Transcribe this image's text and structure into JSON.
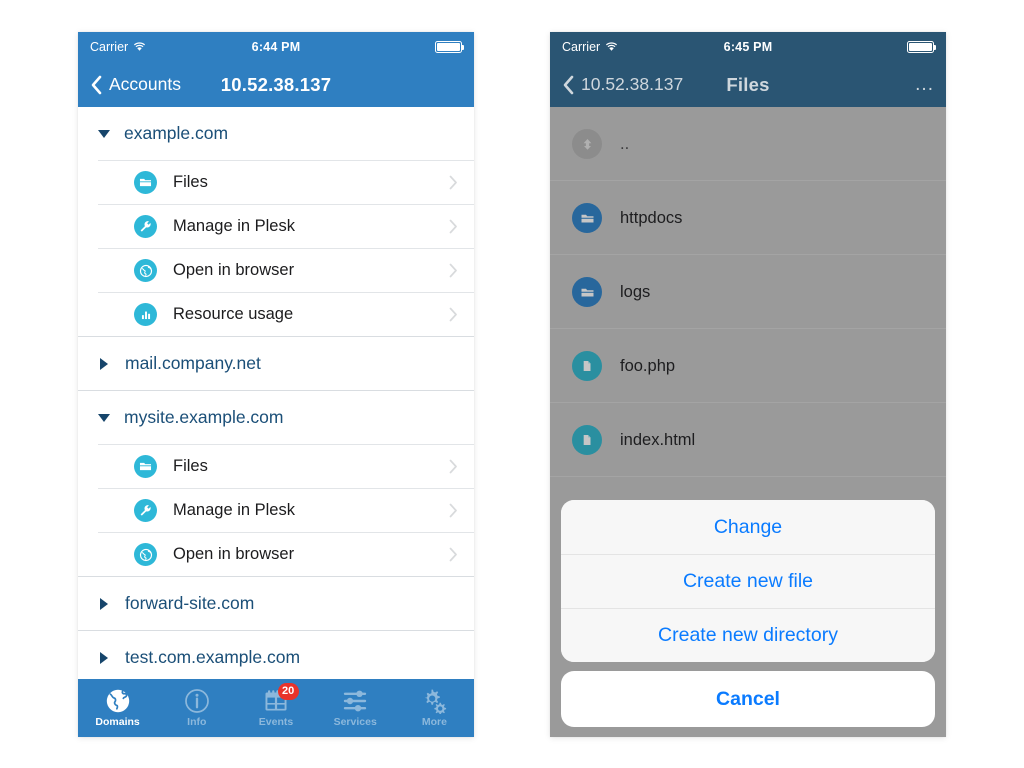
{
  "colors": {
    "nav_blue": "#2f7fc1",
    "nav_blue_dimmed": "#2a5573",
    "icon_cyan": "#2eb8d8",
    "domain_text": "#1b4f78",
    "badge_red": "#e8332a",
    "action_blue": "#0a7bff",
    "dim_overlay": "#9a9a9a",
    "dir_icon_blue": "#28679c",
    "file_icon_teal": "#2a8fa0"
  },
  "left_phone": {
    "status_bar": {
      "carrier": "Carrier",
      "wifi_icon": "wifi-icon",
      "time": "6:44 PM",
      "battery_icon": "battery-full-icon"
    },
    "nav": {
      "back_icon": "chevron-left-icon",
      "back_label": "Accounts",
      "title": "10.52.38.137"
    },
    "groups": [
      {
        "domain": "example.com",
        "expanded": true,
        "disclosure_icon": "triangle-down-icon",
        "items": [
          {
            "label": "Files",
            "icon": "folder-icon",
            "chevron": "chevron-right-icon"
          },
          {
            "label": "Manage in Plesk",
            "icon": "wrench-icon",
            "chevron": "chevron-right-icon"
          },
          {
            "label": "Open in browser",
            "icon": "globe-icon",
            "chevron": "chevron-right-icon"
          },
          {
            "label": "Resource usage",
            "icon": "bar-chart-icon",
            "chevron": "chevron-right-icon"
          }
        ]
      },
      {
        "domain": "mail.company.net",
        "expanded": false,
        "disclosure_icon": "triangle-right-icon",
        "items": []
      },
      {
        "domain": "mysite.example.com",
        "expanded": true,
        "disclosure_icon": "triangle-down-icon",
        "items": [
          {
            "label": "Files",
            "icon": "folder-icon",
            "chevron": "chevron-right-icon"
          },
          {
            "label": "Manage in Plesk",
            "icon": "wrench-icon",
            "chevron": "chevron-right-icon"
          },
          {
            "label": "Open in browser",
            "icon": "globe-icon",
            "chevron": "chevron-right-icon"
          }
        ]
      },
      {
        "domain": "forward-site.com",
        "expanded": false,
        "disclosure_icon": "triangle-right-icon",
        "items": []
      },
      {
        "domain": "test.com.example.com",
        "expanded": false,
        "disclosure_icon": "triangle-right-icon",
        "items": []
      }
    ],
    "tabbar": [
      {
        "label": "Domains",
        "icon": "globe-icon",
        "active": true,
        "badge": null
      },
      {
        "label": "Info",
        "icon": "info-icon",
        "active": false,
        "badge": null
      },
      {
        "label": "Events",
        "icon": "calendar-icon",
        "active": false,
        "badge": "20"
      },
      {
        "label": "Services",
        "icon": "sliders-icon",
        "active": false,
        "badge": null
      },
      {
        "label": "More",
        "icon": "gears-icon",
        "active": false,
        "badge": null
      }
    ]
  },
  "right_phone": {
    "status_bar": {
      "carrier": "Carrier",
      "wifi_icon": "wifi-icon",
      "time": "6:45 PM",
      "battery_icon": "battery-full-icon"
    },
    "nav": {
      "back_icon": "chevron-left-icon",
      "back_label": "10.52.38.137",
      "title": "Files",
      "more_label": "..."
    },
    "files": [
      {
        "name": "..",
        "kind": "up",
        "icon": "arrow-up-circle-icon"
      },
      {
        "name": "httpdocs",
        "kind": "dir",
        "icon": "folder-icon"
      },
      {
        "name": "logs",
        "kind": "dir",
        "icon": "folder-icon"
      },
      {
        "name": "foo.php",
        "kind": "file",
        "icon": "document-icon"
      },
      {
        "name": "index.html",
        "kind": "file",
        "icon": "document-icon"
      }
    ],
    "action_sheet": {
      "buttons": [
        {
          "label": "Change"
        },
        {
          "label": "Create new file"
        },
        {
          "label": "Create new directory"
        }
      ],
      "cancel_label": "Cancel"
    }
  }
}
